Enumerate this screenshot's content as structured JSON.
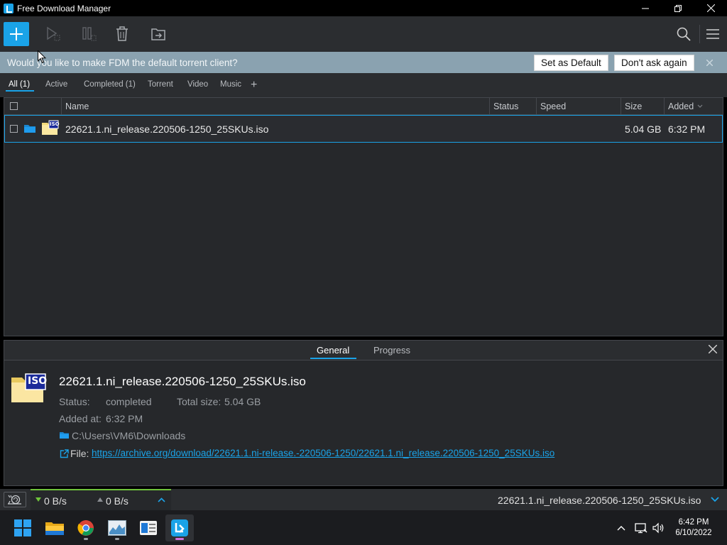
{
  "window": {
    "title": "Free Download Manager"
  },
  "toolbar": {
    "add_icon": "plus-icon",
    "start_icon": "play-icon",
    "pause_icon": "pause-icon",
    "delete_icon": "trash-icon",
    "move_icon": "folder-move-icon",
    "search_icon": "search-icon",
    "menu_icon": "hamburger-menu-icon",
    "accent_color": "#1aa3e8"
  },
  "notice": {
    "message": "Would you like to make FDM the default torrent client?",
    "set_default_label": "Set as Default",
    "dont_ask_label": "Don't ask again"
  },
  "filters": {
    "tabs": [
      {
        "label": "All (1)",
        "active": true
      },
      {
        "label": "Active",
        "active": false
      },
      {
        "label": "Completed (1)",
        "active": false
      },
      {
        "label": "Torrent",
        "active": false
      },
      {
        "label": "Video",
        "active": false
      },
      {
        "label": "Music",
        "active": false
      }
    ],
    "add_label": "+"
  },
  "table": {
    "columns": {
      "name": "Name",
      "status": "Status",
      "speed": "Speed",
      "size": "Size",
      "added": "Added"
    },
    "rows": [
      {
        "name": "22621.1.ni_release.220506-1250_25SKUs.iso",
        "status": "",
        "speed": "",
        "size": "5.04 GB",
        "added": "6:32 PM",
        "icon_text": "ISO"
      }
    ]
  },
  "details": {
    "tabs": {
      "general": "General",
      "progress": "Progress"
    },
    "filename": "22621.1.ni_release.220506-1250_25SKUs.iso",
    "status_label": "Status:",
    "status_value": "completed",
    "total_size_label": "Total size:",
    "total_size_value": "5.04 GB",
    "added_label": "Added at:",
    "added_value": "6:32 PM",
    "folder": "C:\\Users\\VM6\\Downloads",
    "file_label": "File:",
    "file_url": "https://archive.org/download/22621.1.ni-release.-220506-1250/22621.1.ni_release.220506-1250_25SKUs.iso"
  },
  "statusbar": {
    "download_speed": "0 B/s",
    "upload_speed": "0 B/s",
    "current_file": "22621.1.ni_release.220506-1250_25SKUs.iso",
    "speed_accent": "#6fc43b"
  },
  "taskbar": {
    "apps": [
      "start-icon",
      "file-explorer-icon",
      "chrome-icon",
      "task-manager-icon",
      "news-icon",
      "fdm-icon"
    ],
    "time": "6:42 PM",
    "date": "6/10/2022"
  }
}
